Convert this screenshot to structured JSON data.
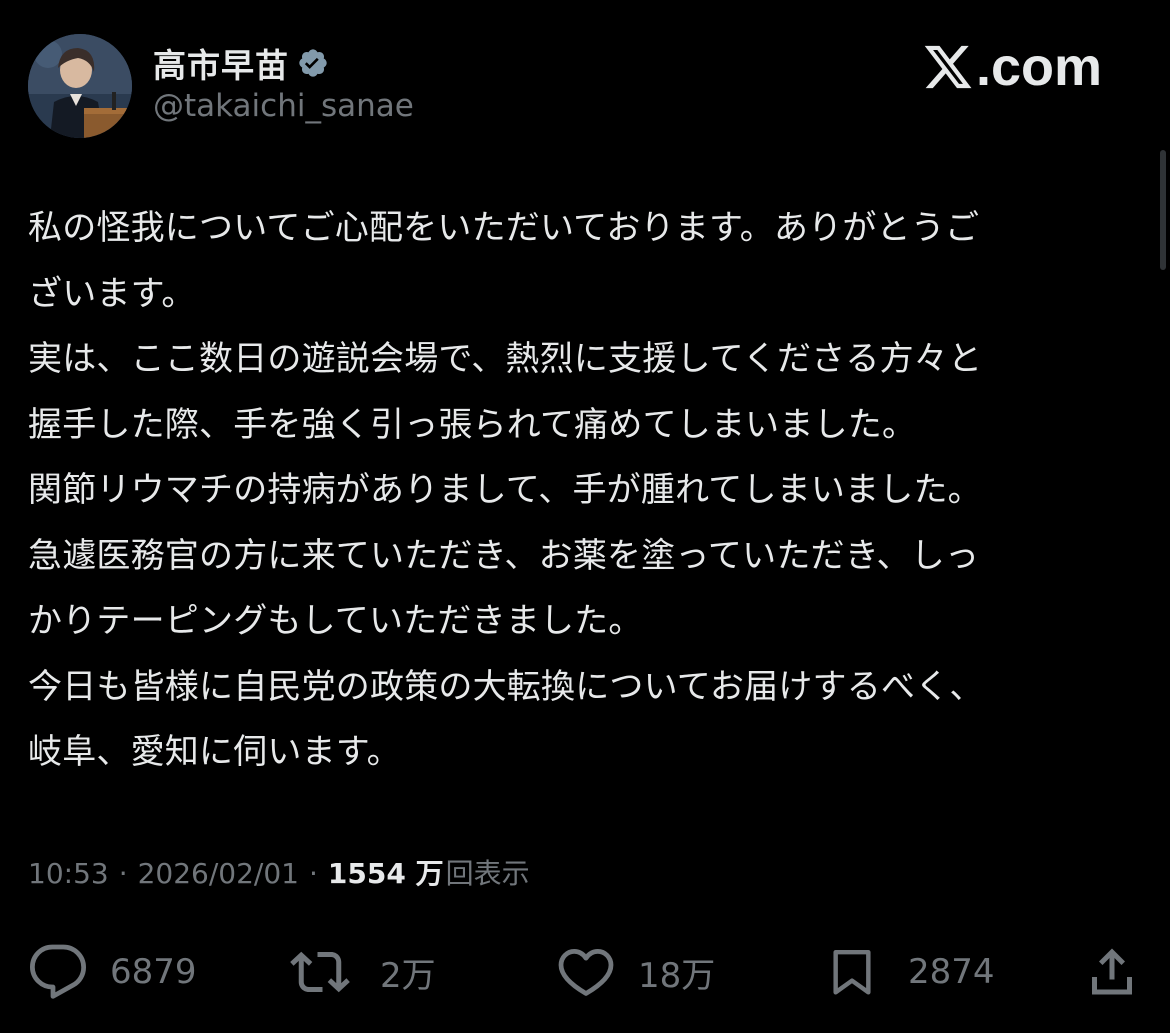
{
  "author": {
    "name": "高市早苗",
    "handle": "@takaichi_sanae",
    "verified": true
  },
  "brand": {
    "label": ".com",
    "x_symbol": "x-logo-icon"
  },
  "post": {
    "lines": [
      "私の怪我についてご心配をいただいております。ありがとうご",
      "ざいます。",
      "実は、ここ数日の遊説会場で、熱烈に支援してくださる方々と",
      "握手した際、手を強く引っ張られて痛めてしまいました。",
      "関節リウマチの持病がありまして、手が腫れてしまいました。",
      "急遽医務官の方に来ていただき、お薬を塗っていただき、しっ",
      "かりテーピングもしていただきました。",
      "今日も皆様に自民党の政策の大転換についてお届けするべく、",
      "岐阜、愛知に伺います。"
    ]
  },
  "meta": {
    "time": "10:53",
    "separator": "·",
    "date": "2026/02/01",
    "views_count": "1554 万",
    "views_label": "回表示"
  },
  "actions": {
    "replies": "6879",
    "reposts": "2万",
    "likes": "18万",
    "bookmarks": "2874"
  },
  "colors": {
    "background": "#000000",
    "text": "#e7e9ea",
    "muted": "#71767b",
    "verified_badge": "#829aab"
  }
}
